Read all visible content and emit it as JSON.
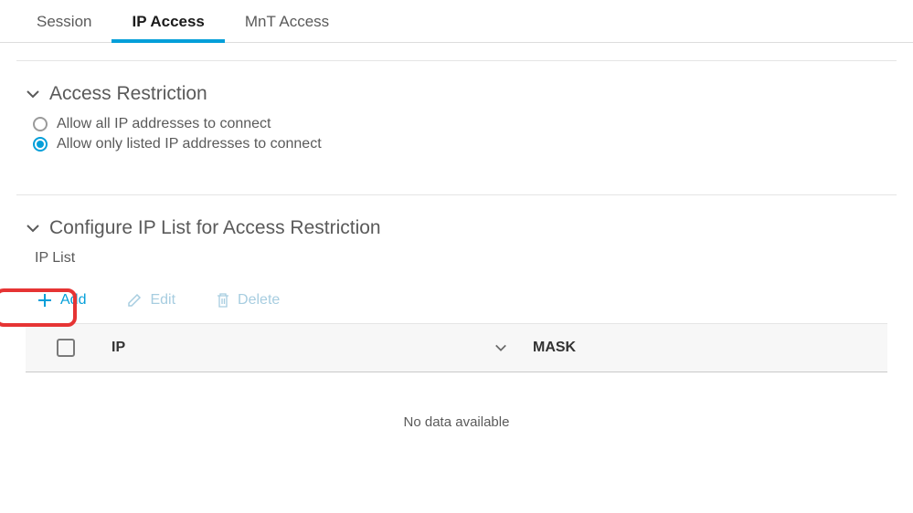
{
  "tabs": {
    "session": "Session",
    "ip_access": "IP Access",
    "mnt_access": "MnT Access"
  },
  "access_restriction": {
    "title": "Access Restriction",
    "opt_allow_all": "Allow all IP addresses to connect",
    "opt_allow_listed": "Allow only listed IP addresses to connect"
  },
  "ip_list_section": {
    "title": "Configure IP List for Access Restriction",
    "subtitle": "IP List"
  },
  "toolbar": {
    "add": "Add",
    "edit": "Edit",
    "delete": "Delete"
  },
  "table": {
    "col_ip": "IP",
    "col_mask": "MASK",
    "empty": "No data available"
  }
}
